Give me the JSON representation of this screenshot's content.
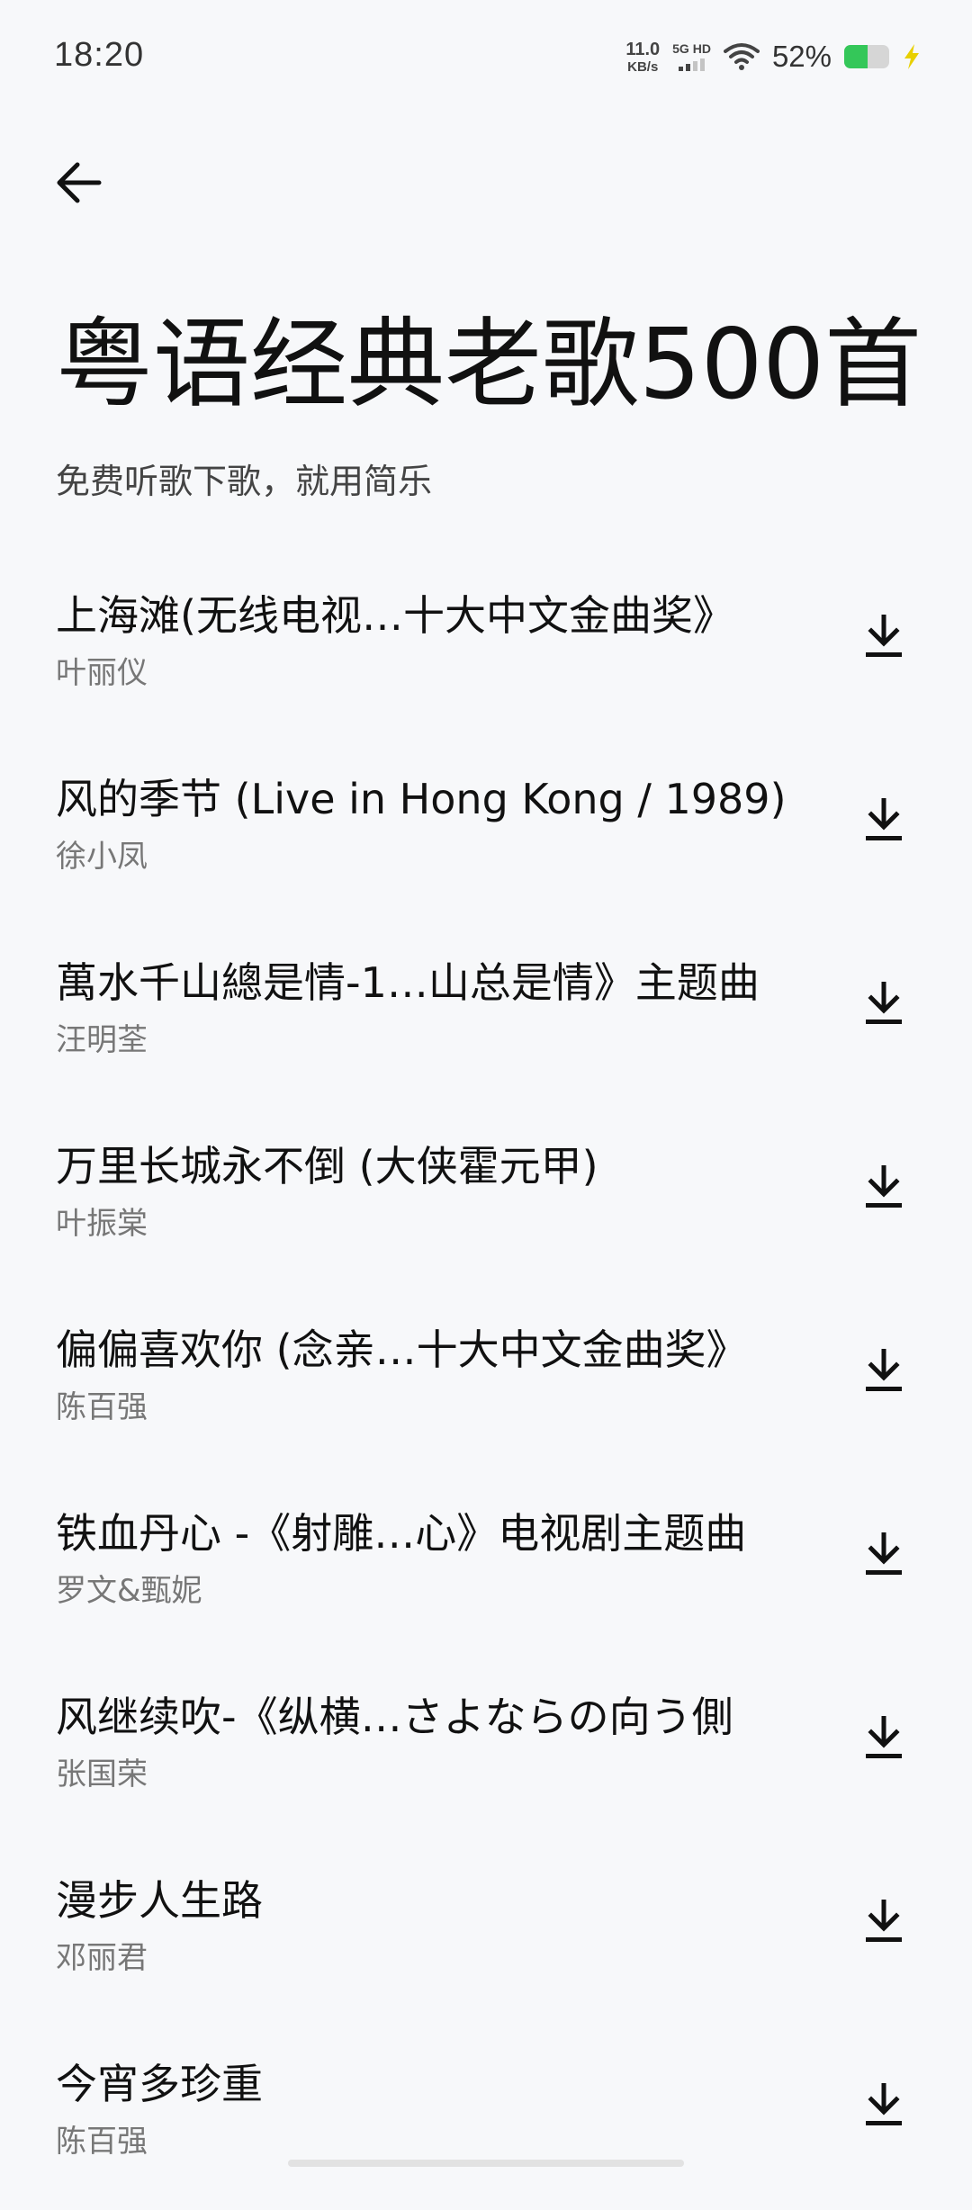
{
  "status_bar": {
    "time": "18:20",
    "net_speed_value": "11.0",
    "net_speed_unit": "KB/s",
    "network_label": "5G HD",
    "battery_percent": "52%",
    "battery_level": 0.52,
    "battery_color": "#34c759",
    "icons": [
      "signal-bars-icon",
      "wifi-icon",
      "battery-icon",
      "charging-bolt-icon"
    ]
  },
  "header": {
    "back_icon": "back-arrow-icon",
    "title": "粤语经典老歌500首",
    "subtitle": "免费听歌下歌，就用简乐"
  },
  "songs": [
    {
      "title": "上海滩(无线电视…十大中文金曲奖》",
      "artist": "叶丽仪"
    },
    {
      "title": "风的季节 (Live in Hong Kong / 1989)",
      "artist": "徐小凤"
    },
    {
      "title": "萬水千山總是情-1…山总是情》主题曲",
      "artist": "汪明荃"
    },
    {
      "title": "万里长城永不倒 (大侠霍元甲)",
      "artist": "叶振棠"
    },
    {
      "title": "偏偏喜欢你 (念亲…十大中文金曲奖》",
      "artist": "陈百强"
    },
    {
      "title": "铁血丹心 -《射雕…心》电视剧主题曲",
      "artist": "罗文&甄妮"
    },
    {
      "title": "风继续吹-《纵横…さよならの向う側",
      "artist": "张国荣"
    },
    {
      "title": "漫步人生路",
      "artist": "邓丽君"
    },
    {
      "title": "今宵多珍重",
      "artist": "陈百强"
    }
  ],
  "download_icon": "download-icon"
}
